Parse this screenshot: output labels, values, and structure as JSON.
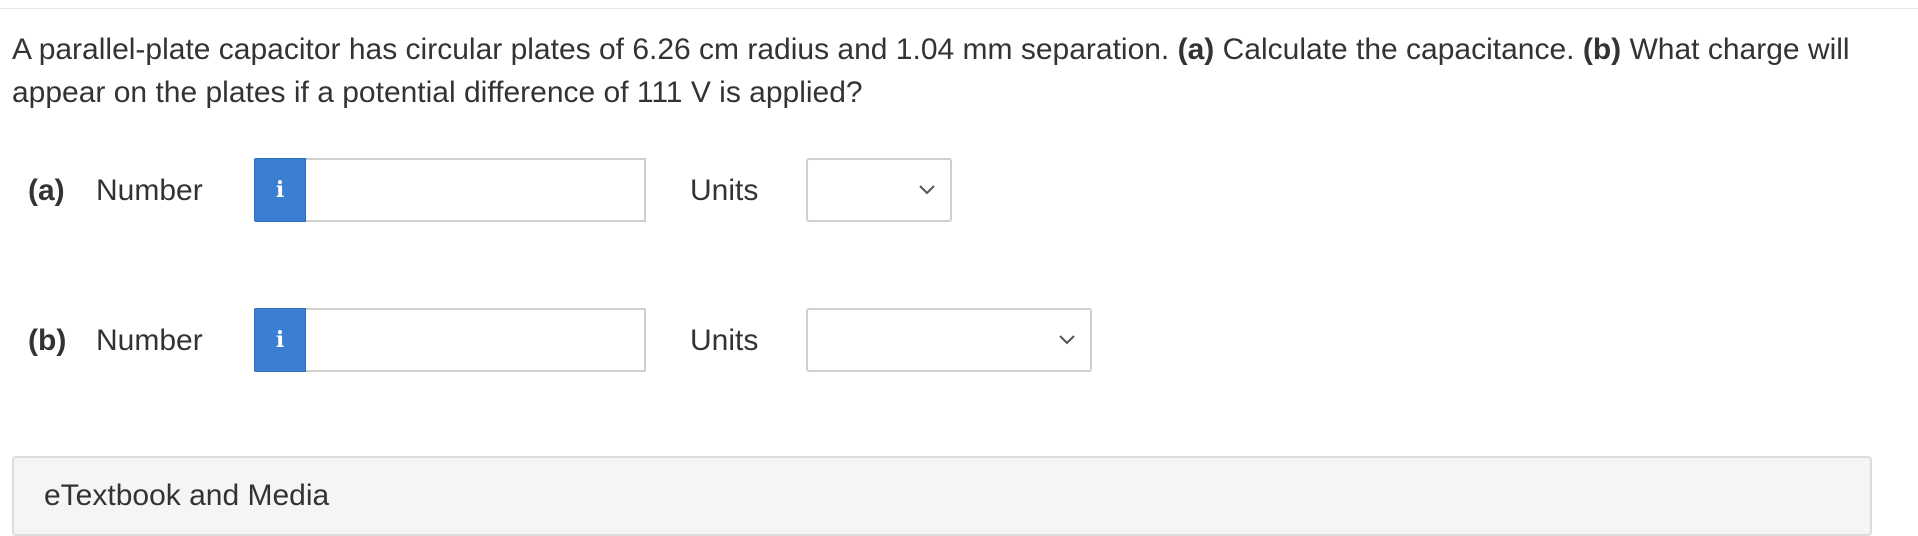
{
  "question": {
    "text_1": "A parallel-plate capacitor has circular plates of 6.26 cm radius and 1.04 mm separation. ",
    "part_a_marker": "(a)",
    "text_2": " Calculate the capacitance. ",
    "part_b_marker": "(b)",
    "text_3": " What charge will appear on the plates if a potential difference of 111 V is applied?"
  },
  "answers": [
    {
      "part_label": "(a)",
      "number_label": "Number",
      "info_icon_glyph": "i",
      "number_value": "",
      "units_label": "Units",
      "units_selected": ""
    },
    {
      "part_label": "(b)",
      "number_label": "Number",
      "info_icon_glyph": "i",
      "number_value": "",
      "units_label": "Units",
      "units_selected": ""
    }
  ],
  "media_panel": {
    "title": "eTextbook and Media"
  },
  "colors": {
    "info_button": "#3a7fd2",
    "input_border": "#cfcfcf",
    "panel_background": "#f5f5f5",
    "text": "#333333"
  },
  "icons": {
    "info": "info-icon",
    "dropdown": "chevron-down-icon"
  }
}
